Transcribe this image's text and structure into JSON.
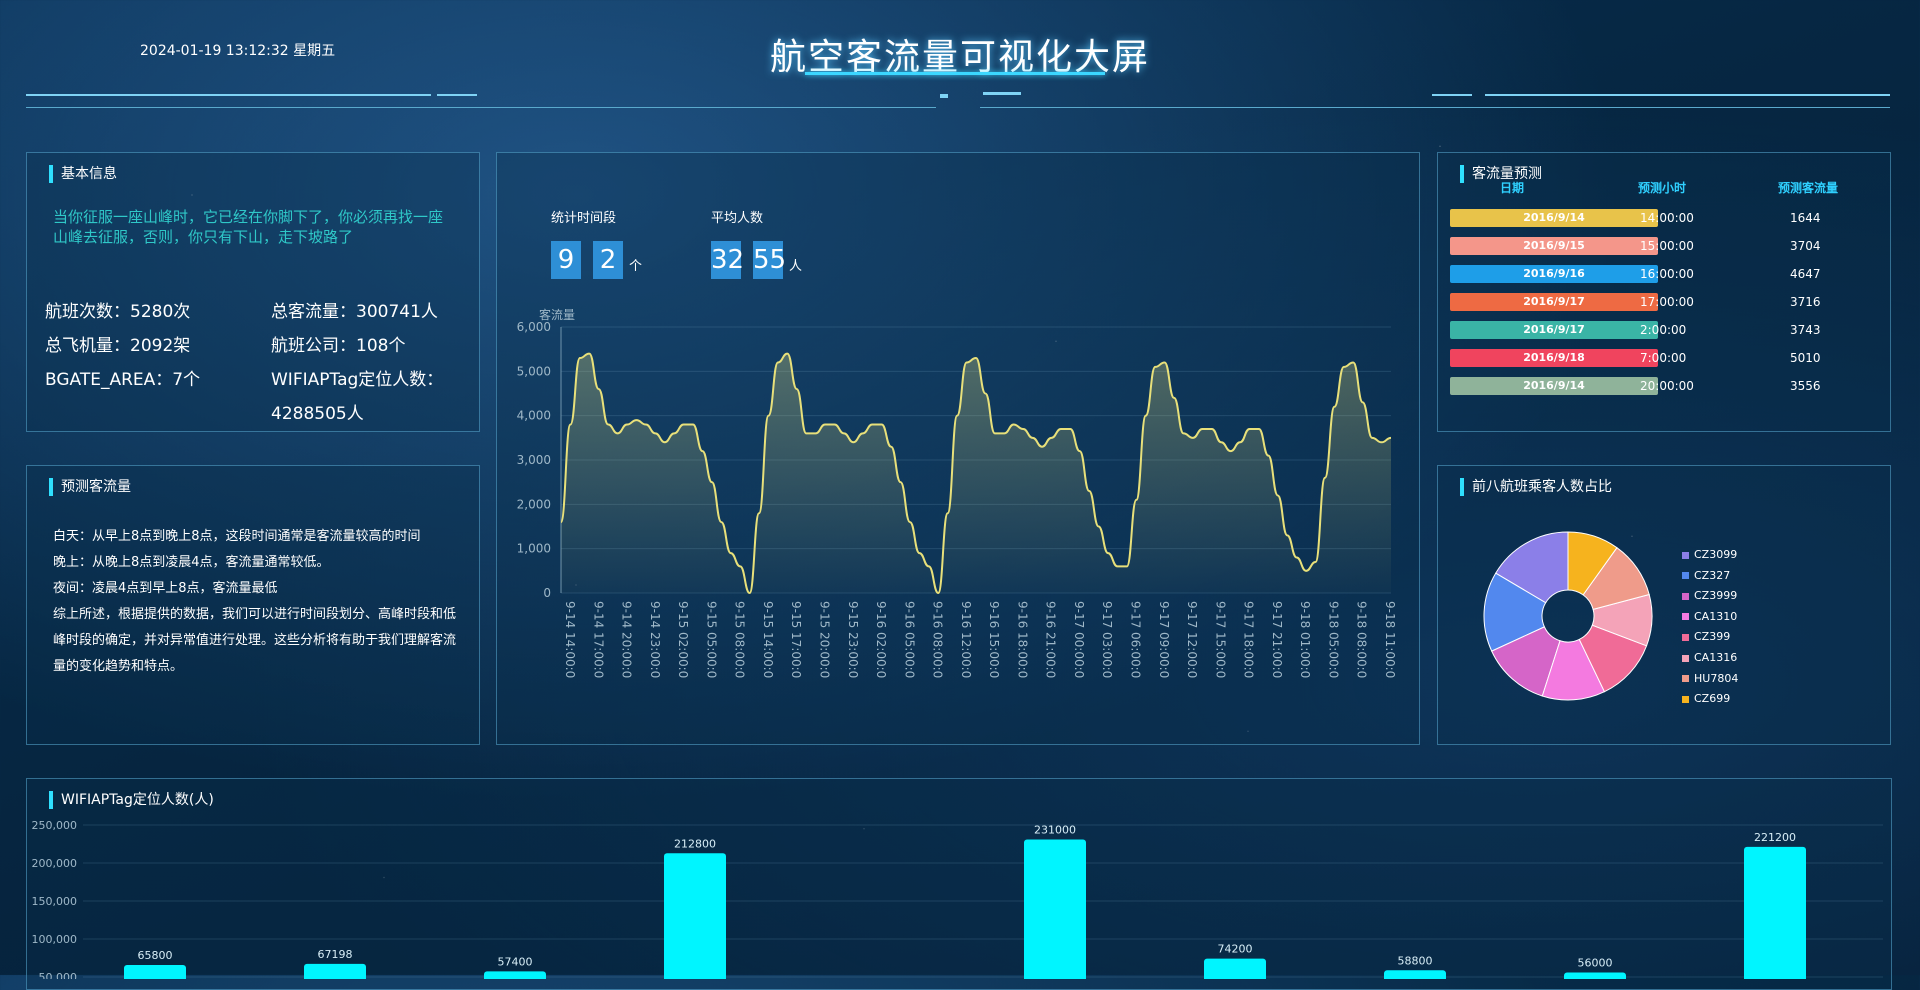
{
  "header": {
    "datetime": "2024-01-19  13:12:32  星期五",
    "title": "航空客流量可视化大屏"
  },
  "basic_info": {
    "title": "基本信息",
    "quote": "当你征服一座山峰时，它已经在你脚下了，你必须再找一座山峰去征服，否则，你只有下山，走下坡路了",
    "flights": "航班次数：5280次",
    "total_flow": "总客流量：300741人",
    "planes": "总飞机量：2092架",
    "airlines": "航班公司：108个",
    "bgate": "BGATE_AREA：7个",
    "wifi_label": "WIFIAPTag定位人数：",
    "wifi_value": "4288505人"
  },
  "predict_flow": {
    "title": "预测客流量",
    "text": "白天：从早上8点到晚上8点，这段时间通常是客流量较高的时间\n晚上：从晚上8点到凌晨4点，客流量通常较低。\n夜间：凌晨4点到早上8点，客流量最低\n综上所述，根据提供的数据，我们可以进行时间段划分、高峰时段和低峰时段的确定，并对异常值进行处理。这些分析将有助于我们理解客流量的变化趋势和特点。"
  },
  "stats": {
    "period_label": "统计时间段",
    "period_digits": [
      "9",
      "2"
    ],
    "period_unit": "个",
    "avg_label": "平均人数",
    "avg_digits": [
      "32",
      "55"
    ],
    "avg_unit": "人"
  },
  "forecast_table": {
    "title": "客流量预测",
    "headers": [
      "日期",
      "预测小时",
      "预测客流量"
    ],
    "rows": [
      {
        "date": "2016/9/14",
        "hour": "14:00:00",
        "flow": "1644",
        "color": "#e8c34a"
      },
      {
        "date": "2016/9/15",
        "hour": "15:00:00",
        "flow": "3704",
        "color": "#f4968a"
      },
      {
        "date": "2016/9/16",
        "hour": "16:00:00",
        "flow": "4647",
        "color": "#1e9ee8"
      },
      {
        "date": "2016/9/17",
        "hour": "17:00:00",
        "flow": "3716",
        "color": "#ee6a43"
      },
      {
        "date": "2016/9/17",
        "hour": "2:00:00",
        "flow": "3743",
        "color": "#3ab4a6"
      },
      {
        "date": "2016/9/18",
        "hour": "7:00:00",
        "flow": "5010",
        "color": "#f0445e"
      },
      {
        "date": "2016/9/14",
        "hour": "20:00:00",
        "flow": "3556",
        "color": "#8fb39a"
      }
    ]
  },
  "pie_panel": {
    "title": "前八航班乘客人数占比"
  },
  "bar_panel": {
    "title": "WIFIAPTag定位人数(人)"
  },
  "chart_data": [
    {
      "type": "line",
      "ylabel": "客流量",
      "ylim": [
        0,
        6000
      ],
      "y_ticks": [
        "6,000",
        "5,000",
        "4,000",
        "3,000",
        "2,000",
        "1,000",
        "0"
      ],
      "x_tick_labels": [
        "9-14 14:00:0",
        "9-14 17:00:0",
        "9-14 20:00:0",
        "9-14 23:00:0",
        "9-15 02:00:0",
        "9-15 05:00:0",
        "9-15 08:00:0",
        "9-15 14:00:0",
        "9-15 17:00:0",
        "9-15 20:00:0",
        "9-15 23:00:0",
        "9-16 02:00:0",
        "9-16 05:00:0",
        "9-16 08:00:0",
        "9-16 12:00:0",
        "9-16 15:00:0",
        "9-16 18:00:0",
        "9-16 21:00:0",
        "9-17 00:00:0",
        "9-17 03:00:0",
        "9-17 06:00:0",
        "9-17 09:00:0",
        "9-17 12:00:0",
        "9-17 15:00:0",
        "9-17 18:00:0",
        "9-17 21:00:0",
        "9-18 01:00:0",
        "9-18 05:00:0",
        "9-18 08:00:0",
        "9-18 11:00:0"
      ],
      "values": [
        1600,
        3800,
        5300,
        5400,
        4600,
        3800,
        3600,
        3800,
        3900,
        3800,
        3600,
        3400,
        3600,
        3800,
        3800,
        3200,
        2500,
        1600,
        900,
        600,
        0,
        1800,
        4000,
        5200,
        5400,
        4600,
        3600,
        3600,
        3800,
        3800,
        3600,
        3400,
        3600,
        3800,
        3800,
        3300,
        2500,
        1600,
        900,
        600,
        0,
        1800,
        4000,
        5200,
        5300,
        4500,
        3600,
        3600,
        3800,
        3700,
        3500,
        3300,
        3500,
        3700,
        3700,
        3200,
        2300,
        1500,
        900,
        600,
        600,
        2100,
        4000,
        5100,
        5200,
        4400,
        3600,
        3500,
        3700,
        3700,
        3400,
        3200,
        3400,
        3700,
        3700,
        3100,
        2200,
        1300,
        800,
        500,
        700,
        2600,
        4200,
        5100,
        5200,
        4300,
        3500,
        3400,
        3500
      ]
    },
    {
      "type": "pie",
      "labels": [
        "CZ3099",
        "CZ327",
        "CZ3999",
        "CA1310",
        "CZ399",
        "CA1316",
        "HU7804",
        "CZ699"
      ],
      "values": [
        15,
        14,
        12,
        11,
        11,
        9,
        10,
        9
      ],
      "colors": [
        "#8b7fe8",
        "#5288ee",
        "#d565c8",
        "#f47ae0",
        "#f06b97",
        "#f4a3b8",
        "#ef9b8a",
        "#f6b31e"
      ],
      "legend": "right"
    },
    {
      "type": "bar",
      "ylim": [
        0,
        250000
      ],
      "y_ticks": [
        "250,000",
        "200,000",
        "150,000",
        "100,000",
        "50,000"
      ],
      "values": [
        65800,
        67198,
        57400,
        212800,
        0,
        231000,
        74200,
        58800,
        56000,
        221200
      ],
      "labels": [
        "65800",
        "67198",
        "57400",
        "212800",
        "",
        "231000",
        "74200",
        "58800",
        "56000",
        "221200"
      ],
      "color": "#00f5ff"
    }
  ]
}
